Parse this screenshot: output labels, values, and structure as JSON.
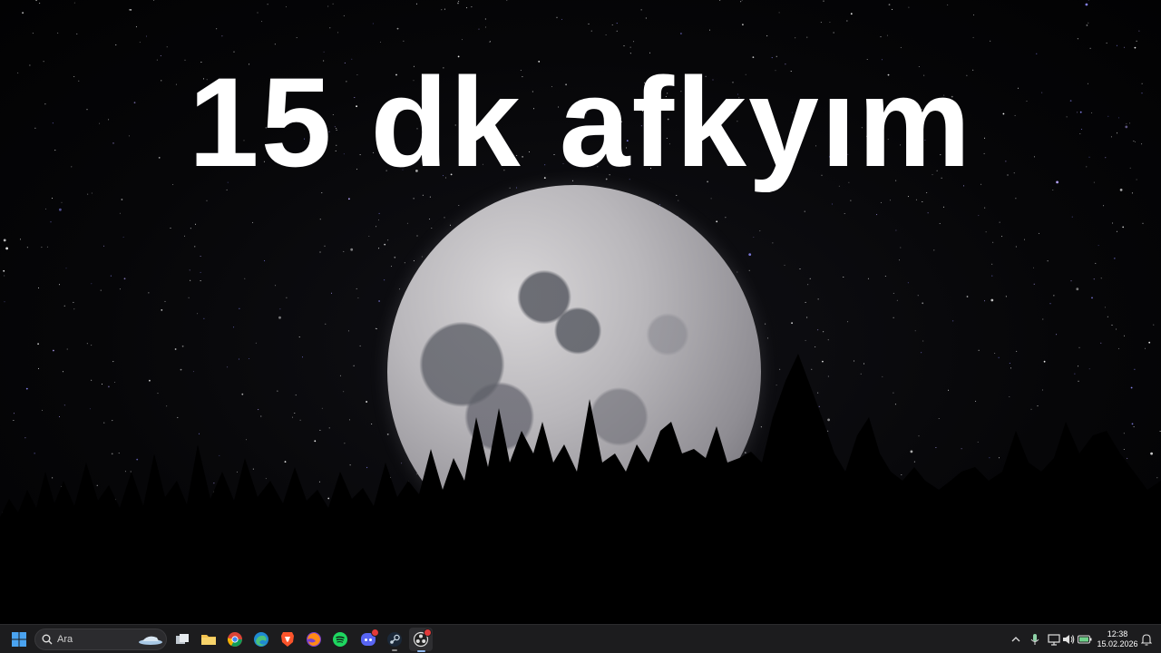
{
  "desktop": {
    "headline": "15 dk afkyım",
    "wallpaper": "night sky with full moon and pine tree silhouettes"
  },
  "taskbar": {
    "start_icon": "windows-logo-icon",
    "search": {
      "label": "Ara",
      "icon": "search-icon"
    },
    "apps": [
      {
        "name": "task-view",
        "icon": "task-view-icon"
      },
      {
        "name": "file-explorer",
        "icon": "folder-icon"
      },
      {
        "name": "chrome",
        "icon": "chrome-icon"
      },
      {
        "name": "edge",
        "icon": "edge-icon"
      },
      {
        "name": "brave",
        "icon": "brave-icon"
      },
      {
        "name": "firefox",
        "icon": "firefox-icon"
      },
      {
        "name": "spotify",
        "icon": "spotify-icon"
      },
      {
        "name": "discord",
        "icon": "discord-icon"
      },
      {
        "name": "steam",
        "icon": "steam-icon"
      },
      {
        "name": "obs",
        "icon": "obs-icon"
      }
    ],
    "tray": {
      "icons": [
        "chevron-up-icon",
        "microphone-icon",
        "network-icon",
        "volume-icon",
        "battery-icon",
        "notification-icon"
      ]
    },
    "clock": {
      "time": "12:38",
      "date": "15.02.2026"
    }
  },
  "colors": {
    "taskbar_bg": "#1c1c1e",
    "accent": "#4aa3f0",
    "badge": "#e23a3a"
  }
}
